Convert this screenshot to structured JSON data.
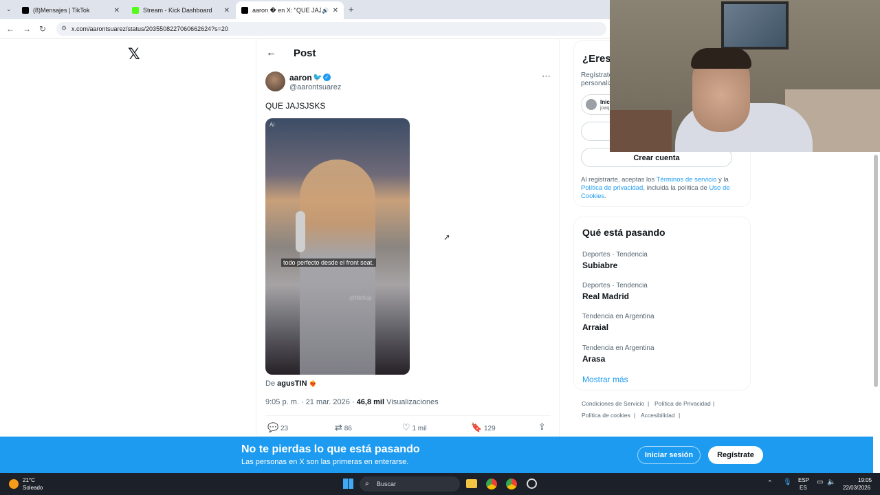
{
  "browser": {
    "tabs": [
      {
        "title": "(8)Mensajes | TikTok",
        "favicon_color": "#000000"
      },
      {
        "title": "Stream - Kick Dashboard",
        "favicon_color": "#53fc18"
      },
      {
        "title": "aaron � en X: \"QUE JAJSJS",
        "favicon_color": "#000000"
      }
    ],
    "url": "x.com/aarontsuarez/status/2035508227060662624?s=20"
  },
  "post": {
    "header_title": "Post",
    "author_name": "aaron",
    "author_handle": "@aarontsuarez",
    "text": "QUE JAJSJSKS",
    "video_subtitle": "todo perfecto desde el front seat.",
    "video_badge": "Ai",
    "video_watermark": "@flikfilop",
    "from_label": "De",
    "from_user": "agusTIN",
    "time": "9:05 p. m. · 21 mar. 2026 ·",
    "views_count": "46,8 mil",
    "views_label": "Visualizaciones",
    "replies": "23",
    "reposts": "86",
    "likes": "1 mil",
    "bookmarks": "129"
  },
  "signup": {
    "title": "¿Eres",
    "desc_line1": "Regístrate",
    "desc_line2": "personaliz",
    "google_label": "Inic",
    "google_sub": "joaq",
    "create_account": "Crear cuenta",
    "legal_pre": "Al registrarte, aceptas los",
    "legal_tos": "Términos de servicio",
    "legal_and": "y la",
    "legal_privacy": "Política de privacidad",
    "legal_mid": ", incluida la política de",
    "legal_cookies": "Uso de Cookies",
    "legal_end": "."
  },
  "trending": {
    "title": "Qué está pasando",
    "items": [
      {
        "category": "Deportes · Tendencia",
        "name": "Subiabre"
      },
      {
        "category": "Deportes · Tendencia",
        "name": "Real Madrid"
      },
      {
        "category": "Tendencia en Argentina",
        "name": "Arraial"
      },
      {
        "category": "Tendencia en Argentina",
        "name": "Arasa"
      }
    ],
    "show_more": "Mostrar más"
  },
  "footer_links": [
    "Condiciones de Servicio",
    "Política de Privacidad",
    "Política de cookies",
    "Accesibilidad"
  ],
  "banner": {
    "title": "No te pierdas lo que está pasando",
    "subtitle": "Las personas en X son las primeras en enterarse.",
    "login": "Iniciar sesión",
    "signup": "Regístrate"
  },
  "taskbar": {
    "temp": "21°C",
    "weather": "Soleado",
    "search_placeholder": "Buscar",
    "lang1": "ESP",
    "lang2": "ES",
    "time": "19:05",
    "date": "22/03/2026"
  },
  "colors": {
    "x_blue": "#1d9bf0",
    "taskbar": "#1c2028"
  }
}
